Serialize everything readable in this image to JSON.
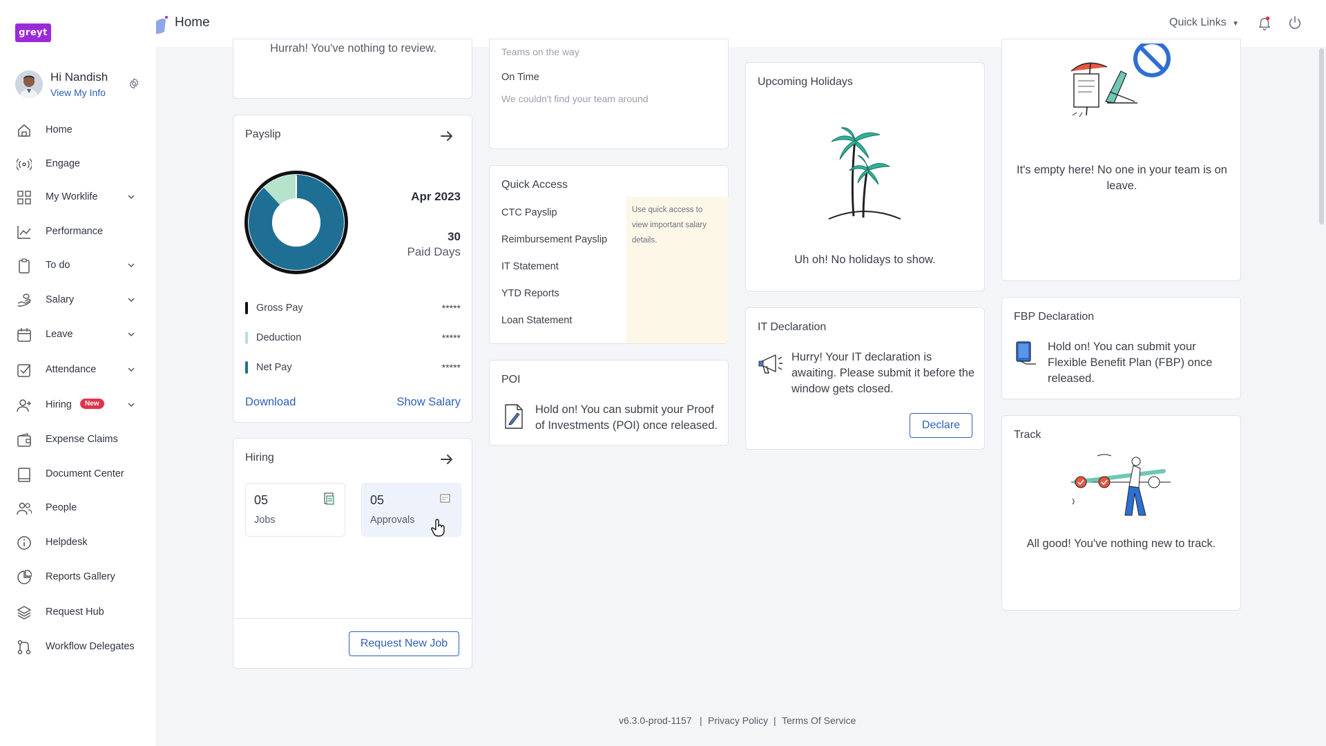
{
  "brand": {
    "logo_text": "greyt",
    "accent": "#9b2ad8",
    "link_color": "#2e5fb8"
  },
  "user": {
    "greeting": "Hi Nandish",
    "view_info": "View My Info"
  },
  "sidebar": {
    "items": [
      {
        "label": "Home",
        "icon": "home-icon",
        "expandable": false
      },
      {
        "label": "Engage",
        "icon": "broadcast-icon",
        "expandable": false
      },
      {
        "label": "My Worklife",
        "icon": "grid-icon",
        "expandable": true
      },
      {
        "label": "Performance",
        "icon": "chart-icon",
        "expandable": false
      },
      {
        "label": "To do",
        "icon": "clipboard-icon",
        "expandable": true
      },
      {
        "label": "Salary",
        "icon": "salary-hand-icon",
        "expandable": true
      },
      {
        "label": "Leave",
        "icon": "calendar-icon",
        "expandable": true
      },
      {
        "label": "Attendance",
        "icon": "check-square-icon",
        "expandable": true
      },
      {
        "label": "Hiring",
        "icon": "add-user-icon",
        "expandable": true,
        "badge": "New"
      },
      {
        "label": "Expense Claims",
        "icon": "wallet-icon",
        "expandable": false
      },
      {
        "label": "Document Center",
        "icon": "book-icon",
        "expandable": false
      },
      {
        "label": "People",
        "icon": "people-icon",
        "expandable": false
      },
      {
        "label": "Helpdesk",
        "icon": "info-icon",
        "expandable": false
      },
      {
        "label": "Reports Gallery",
        "icon": "pie-icon",
        "expandable": false
      },
      {
        "label": "Request Hub",
        "icon": "layers-icon",
        "expandable": false
      },
      {
        "label": "Workflow Delegates",
        "icon": "workflow-icon",
        "expandable": false
      }
    ]
  },
  "header": {
    "title": "Home",
    "quick_links": "Quick Links"
  },
  "review": {
    "text": "Hurrah! You've nothing to review."
  },
  "team": {
    "on_the_way": "Teams on the way",
    "on_time": "On Time",
    "not_found": "We couldn't find your team around"
  },
  "payslip": {
    "title": "Payslip",
    "month": "Apr 2023",
    "paid_days": "30",
    "paid_days_label": "Paid Days",
    "rows": [
      {
        "label": "Gross Pay",
        "value": "*****",
        "color": "#111111"
      },
      {
        "label": "Deduction",
        "value": "*****",
        "color": "#b5e3cc"
      },
      {
        "label": "Net Pay",
        "value": "*****",
        "color": "#1f6f94"
      }
    ],
    "download": "Download",
    "show_salary": "Show Salary"
  },
  "hiring": {
    "title": "Hiring",
    "tiles": [
      {
        "count": "05",
        "label": "Jobs",
        "icon": "jobs-icon"
      },
      {
        "count": "05",
        "label": "Approvals",
        "icon": "approvals-icon"
      }
    ],
    "request_button": "Request New Job"
  },
  "quick_access": {
    "title": "Quick Access",
    "links": [
      "CTC Payslip",
      "Reimbursement Payslip",
      "IT Statement",
      "YTD Reports",
      "Loan Statement"
    ],
    "hint": "Use quick access to view important salary details."
  },
  "poi": {
    "title": "POI",
    "text": "Hold on! You can submit your Proof of Investments (POI) once released."
  },
  "holidays": {
    "title": "Upcoming Holidays",
    "empty": "Uh oh! No holidays to show."
  },
  "it_declaration": {
    "title": "IT Declaration",
    "text": "Hurry! Your IT declaration is awaiting. Please submit it before the window gets closed.",
    "button": "Declare"
  },
  "on_leave": {
    "empty": "It's empty here! No one in your team is on leave."
  },
  "fbp": {
    "title": "FBP Declaration",
    "text": "Hold on! You can submit your Flexible Benefit Plan (FBP) once released."
  },
  "track": {
    "title": "Track",
    "empty": "All good! You've nothing new to track."
  },
  "footer": {
    "version": "v6.3.0-prod-1157",
    "sep": "|",
    "privacy": "Privacy Policy",
    "terms": "Terms Of Service"
  }
}
